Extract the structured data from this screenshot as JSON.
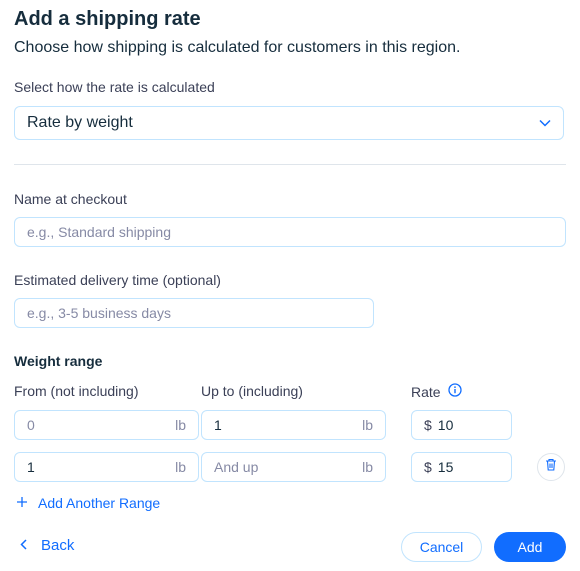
{
  "header": {
    "title": "Add a shipping rate",
    "subtitle": "Choose how shipping is calculated for customers in this region."
  },
  "calculation": {
    "label": "Select how the rate is calculated",
    "selected": "Rate by weight"
  },
  "checkout_name": {
    "label": "Name at checkout",
    "placeholder": "e.g., Standard shipping",
    "value": ""
  },
  "delivery_time": {
    "label": "Estimated delivery time (optional)",
    "placeholder": "e.g., 3-5 business days",
    "value": ""
  },
  "weight_range": {
    "title": "Weight range",
    "col_from": "From (not including)",
    "col_to": "Up to (including)",
    "col_rate": "Rate",
    "unit": "lb",
    "currency": "$",
    "rows": [
      {
        "from_value": "",
        "from_placeholder": "0",
        "to_value": "1",
        "to_placeholder": "",
        "rate": "10"
      },
      {
        "from_value": "1",
        "from_placeholder": "",
        "to_value": "",
        "to_placeholder": "And up",
        "rate": "15"
      }
    ],
    "add_range": "Add Another Range"
  },
  "footer": {
    "back": "Back",
    "cancel": "Cancel",
    "add": "Add"
  },
  "colors": {
    "accent": "#116dff",
    "border": "#c1e4fe",
    "text": "#162d3d",
    "muted": "#868aa5"
  },
  "icons": {
    "dropdown": "chevron-down-icon",
    "info": "info-icon",
    "add": "plus-icon",
    "back": "chevron-left-icon",
    "delete": "trash-icon"
  }
}
